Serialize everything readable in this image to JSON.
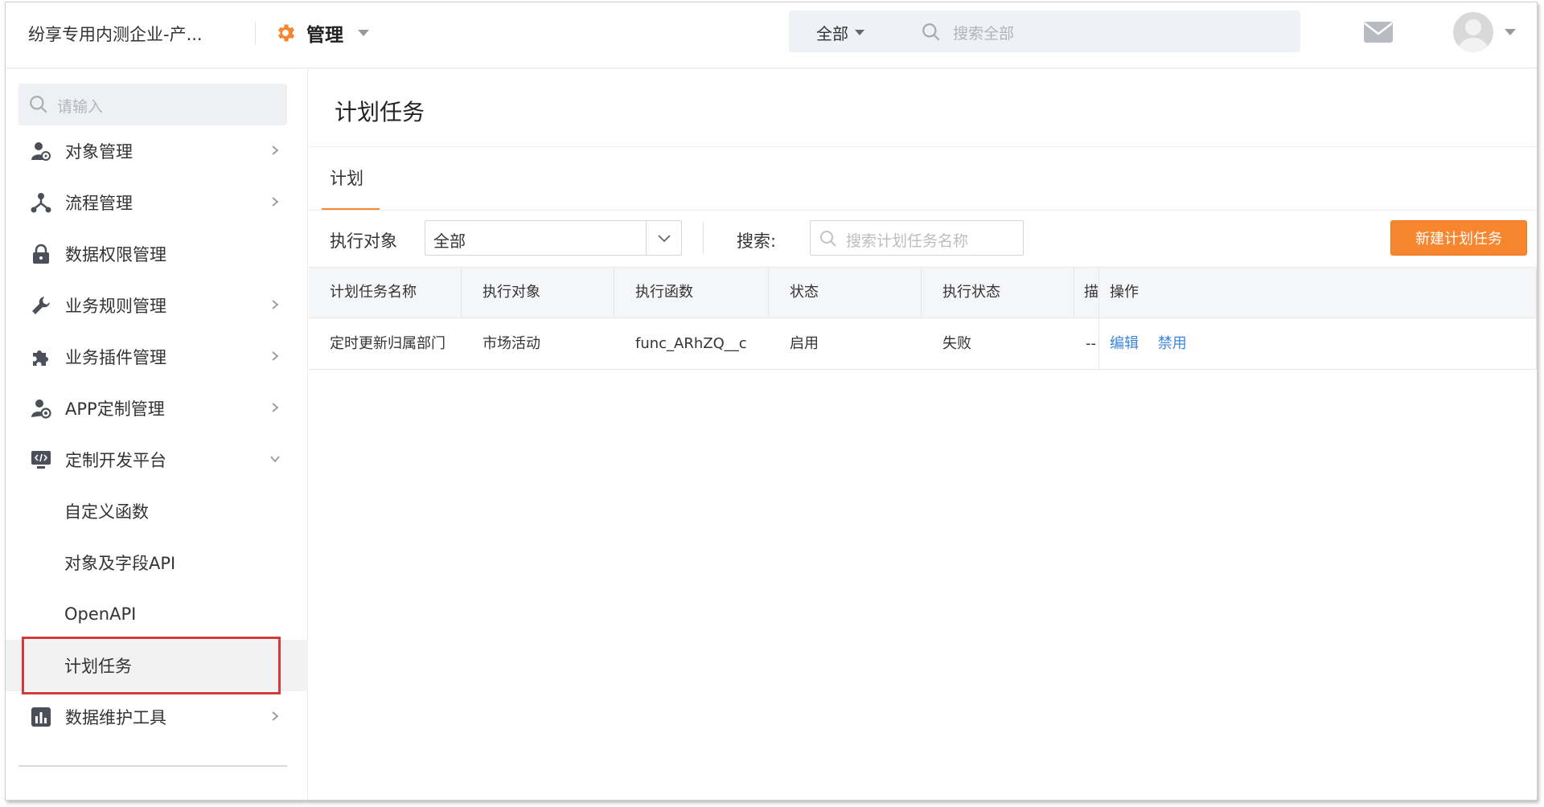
{
  "header": {
    "company": "纷享专用内测企业-产...",
    "app_title": "管理",
    "search_scope": "全部",
    "search_placeholder": "搜索全部"
  },
  "sidebar": {
    "search_placeholder": "请输入",
    "items": [
      {
        "label": "对象管理",
        "icon": "user-object-icon",
        "has_chevron": true
      },
      {
        "label": "流程管理",
        "icon": "flow-icon",
        "has_chevron": true
      },
      {
        "label": "数据权限管理",
        "icon": "lock-icon",
        "has_chevron": false
      },
      {
        "label": "业务规则管理",
        "icon": "wrench-icon",
        "has_chevron": true
      },
      {
        "label": "业务插件管理",
        "icon": "puzzle-icon",
        "has_chevron": true
      },
      {
        "label": "APP定制管理",
        "icon": "app-settings-icon",
        "has_chevron": true
      },
      {
        "label": "定制开发平台",
        "icon": "code-monitor-icon",
        "has_chevron": true,
        "expanded": true
      }
    ],
    "sub_items": [
      "自定义函数",
      "对象及字段API",
      "OpenAPI",
      "计划任务"
    ],
    "last_item": {
      "label": "数据维护工具",
      "icon": "bar-chart-icon",
      "has_chevron": true
    }
  },
  "main": {
    "title": "计划任务",
    "tab": "计划",
    "filter_label": "执行对象",
    "filter_value": "全部",
    "search_label": "搜索:",
    "search_placeholder": "搜索计划任务名称",
    "new_button": "新建计划任务",
    "table": {
      "headers": [
        "计划任务名称",
        "执行对象",
        "执行函数",
        "状态",
        "执行状态",
        "描",
        "操作"
      ],
      "rows": [
        {
          "name": "定时更新归属部门",
          "target": "市场活动",
          "function": "func_ARhZQ__c",
          "status": "启用",
          "exec_status": "失败",
          "desc": "--",
          "actions": [
            "编辑",
            "禁用"
          ]
        }
      ]
    }
  },
  "colors": {
    "accent": "#f7862e",
    "link": "#3b86d9",
    "highlight": "#d33b3b"
  }
}
